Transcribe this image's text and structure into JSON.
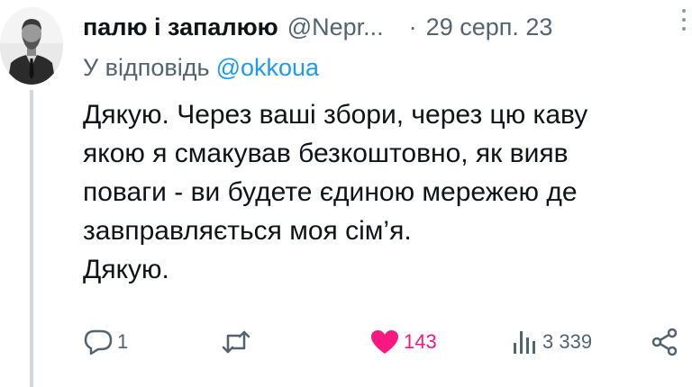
{
  "author": {
    "display_name": "палю і запалюю",
    "handle": "@Nepr...",
    "separator": "·",
    "date": "29 серп. 23"
  },
  "reply": {
    "prefix": "У відповідь",
    "mention": "@okkoua"
  },
  "tweet": {
    "lines": [
      "Дякую. Через ваші збори, через цю каву",
      "якою я смакував безкоштовно, як вияв",
      "поваги - ви будете єдиною мережею де",
      "завправляється моя сім’я.",
      "Дякую."
    ]
  },
  "actions": {
    "reply_count": "1",
    "repost_count": "",
    "like_count": "143",
    "views_count": "3 339",
    "icons": [
      "reply-icon",
      "repost-icon",
      "heart-icon",
      "views-icon",
      "share-icon"
    ]
  },
  "colors": {
    "text": "#0f1419",
    "secondary": "#536471",
    "link": "#1d9bf0",
    "like": "#f91880",
    "thread_line": "#cfd9de"
  }
}
